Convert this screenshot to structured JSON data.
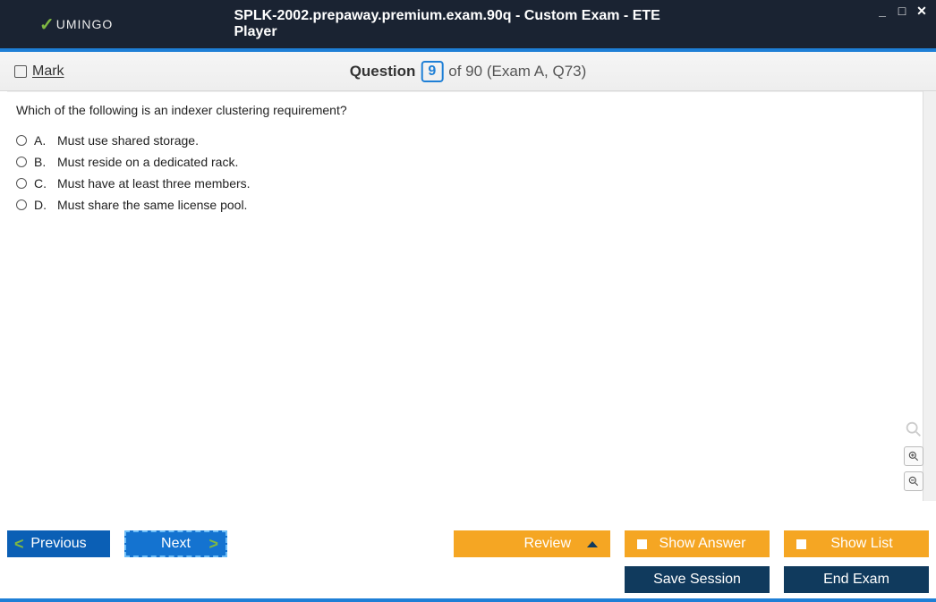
{
  "brand": "UMINGO",
  "window_title": "SPLK-2002.prepaway.premium.exam.90q - Custom Exam - ETE Player",
  "mark_label": "Mark",
  "question_label": "Question",
  "current_question": "9",
  "total_suffix": "of 90 (Exam A, Q73)",
  "question_text": "Which of the following is an indexer clustering requirement?",
  "answers": [
    {
      "letter": "A.",
      "text": "Must use shared storage."
    },
    {
      "letter": "B.",
      "text": "Must reside on a dedicated rack."
    },
    {
      "letter": "C.",
      "text": "Must have at least three members."
    },
    {
      "letter": "D.",
      "text": "Must share the same license pool."
    }
  ],
  "buttons": {
    "previous": "Previous",
    "next": "Next",
    "review": "Review",
    "show_answer": "Show Answer",
    "show_list": "Show List",
    "save_session": "Save Session",
    "end_exam": "End Exam"
  }
}
